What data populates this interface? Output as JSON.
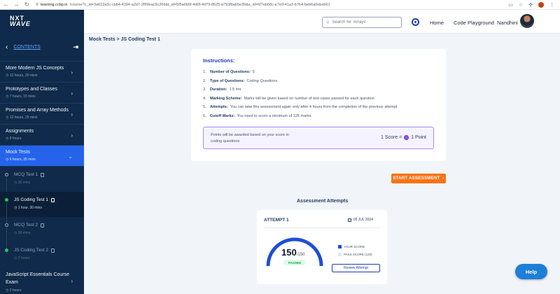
{
  "browser": {
    "url_host": "learning.ccbp.in",
    "url_rest": "/course?c_id=3a622a3c-cb84-4394-a2d7-2f99eac9c266&t_id=5f5a6b5f-4d0f-4d79-8625-a793fbab5e39&s_id=6f7eb68c-e7e9-41a3-b764-beb6a0ebeb61"
  },
  "header": {
    "logo_line1": "NXT",
    "logo_line2": "WAVE",
    "search_placeholder": "Search for 'Arrays'",
    "home": "Home",
    "code_playground": "Code Playground",
    "user_name": "Nandhini"
  },
  "sidebar": {
    "title": "CONTENTS",
    "items": [
      {
        "label": "More Modern JS Concepts",
        "duration": "12 hours, 30 mins"
      },
      {
        "label": "Prototypes and Classes",
        "duration": "7 hours, 15 mins"
      },
      {
        "label": "Promises and Array Methods",
        "duration": "12 hours, 25 mins"
      },
      {
        "label": "Assignments",
        "duration": "9 hours"
      },
      {
        "label": "Mock Tests",
        "duration": "6 hours, 35 mins"
      }
    ],
    "subitems": [
      {
        "label": "MCQ Test 1",
        "duration": "35 mins"
      },
      {
        "label": "JS Coding Test 1",
        "duration": "1 hour, 30 mins"
      },
      {
        "label": "MCQ Test 2",
        "duration": "30 mins"
      },
      {
        "label": "JS Coding Test 2",
        "duration": "2 hours"
      }
    ],
    "last_item": {
      "label": "JavaScript Essentials Course Exam",
      "duration": "2 hours"
    }
  },
  "breadcrumb": "Mock Tests > JS Coding Test 1",
  "instructions": {
    "title": "Instructions:",
    "items": [
      {
        "num": "1.",
        "label": "Number of Questions:",
        "value": "5"
      },
      {
        "num": "2.",
        "label": "Type of Questions:",
        "value": "Coding Questions"
      },
      {
        "num": "3.",
        "label": "Duration:",
        "value": "1.5 hrs"
      },
      {
        "num": "4.",
        "label": "Marking Scheme:",
        "value": "Marks will be given based on number of test cases passed for each question"
      },
      {
        "num": "5.",
        "label": "Attempts:",
        "value": "You can take this assessment again only after 4 hours from the completion of the previous attempt"
      },
      {
        "num": "6.",
        "label": "Cutoff Marks:",
        "value": "You need to score a minimum of 125 marks."
      }
    ],
    "points_text": "Points will be awarded based on your score in coding questions",
    "points_left": "1 Score =",
    "points_right": "1 Point"
  },
  "start_button": "START ASSESSMENT",
  "attempts": {
    "title": "Assessment Attempts",
    "attempt_name": "ATTEMPT 1",
    "date": "05 JUL 2024",
    "score": "150",
    "max": "/150",
    "score_fraction": 1.0,
    "pass_fraction": 0.8,
    "status": "PASSED",
    "legend_your": "YOUR SCORE",
    "legend_pass": "PASS SCORE (120)",
    "review": "Review Attempt"
  },
  "help": "Help",
  "colors": {
    "accent": "#2563eb",
    "navy": "#0f2a4a",
    "orange": "#f97316",
    "pass": "#22c55e"
  }
}
